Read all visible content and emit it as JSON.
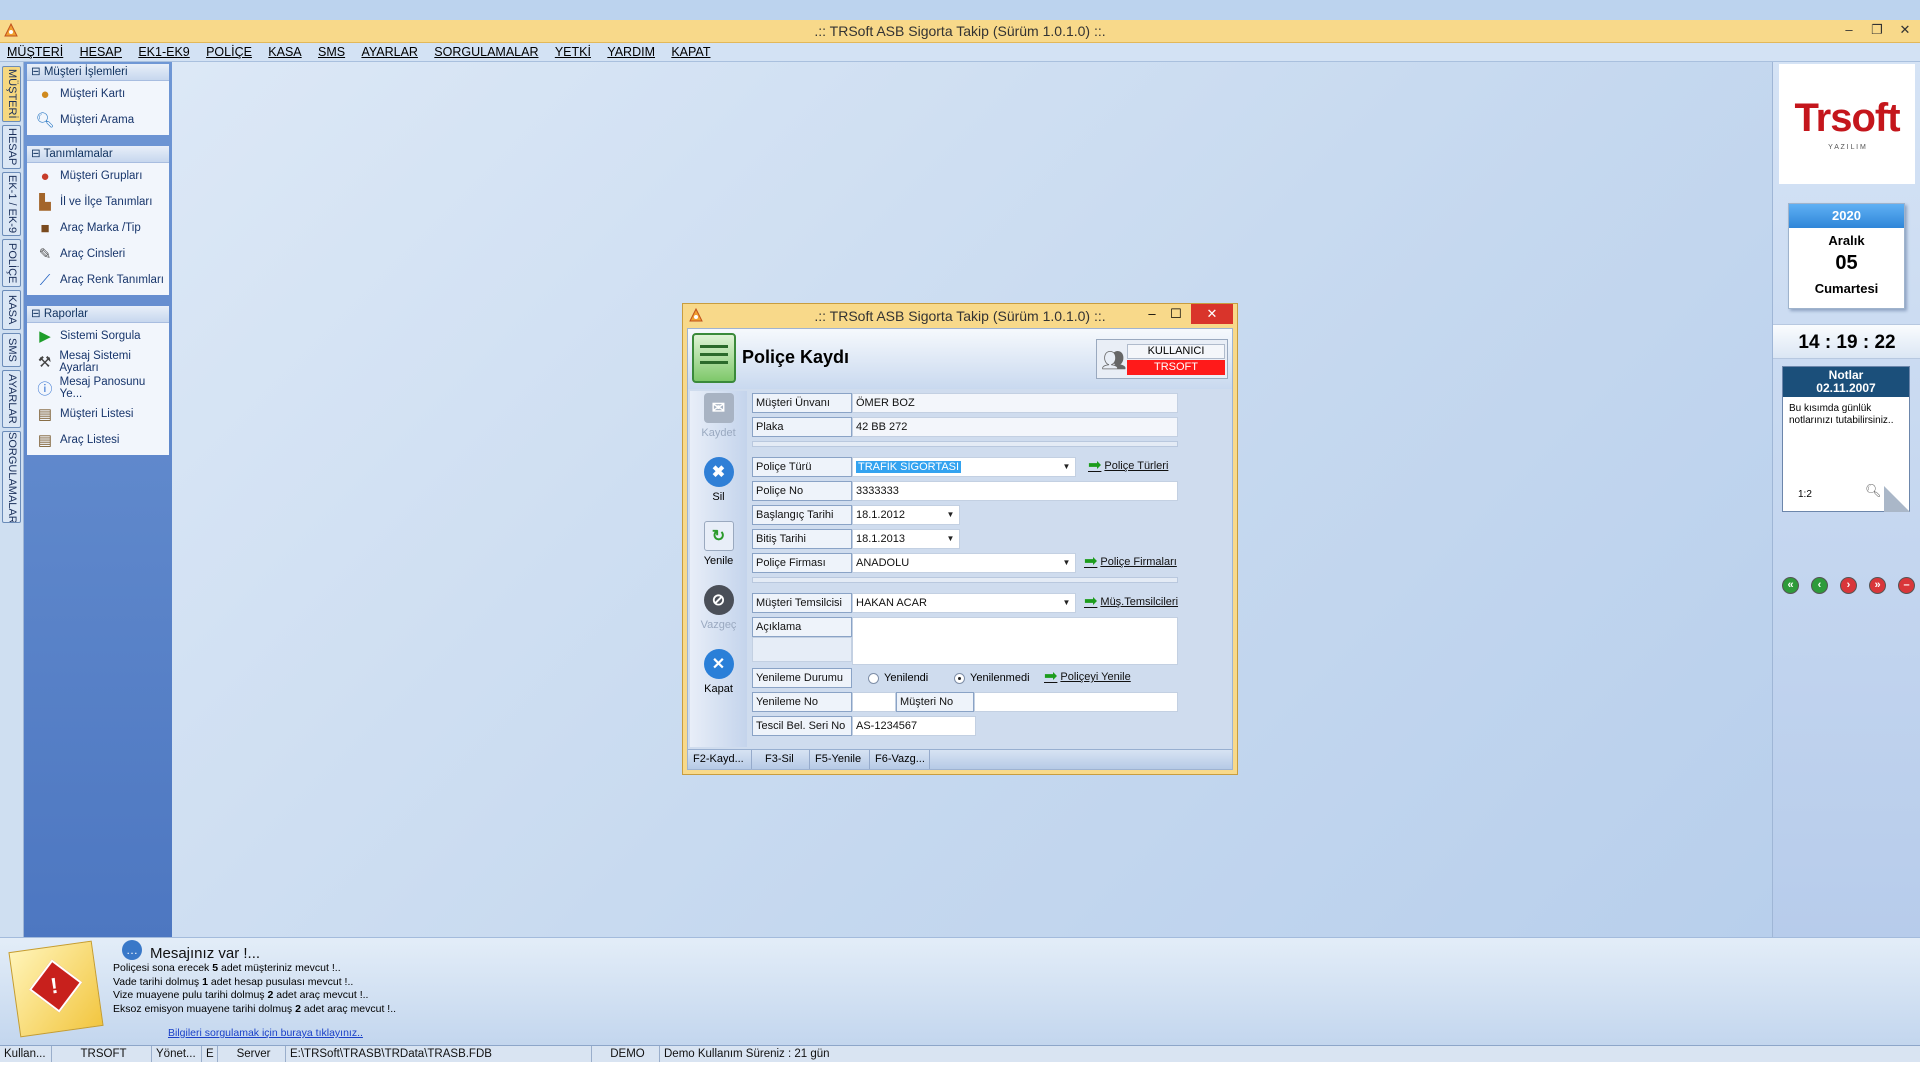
{
  "app": {
    "title": ".:: TRSoft ASB Sigorta Takip (Sürüm 1.0.1.0) ::.",
    "min": "–",
    "max": "❐",
    "close": "✕"
  },
  "menu": [
    "MÜŞTERİ",
    "HESAP",
    "EK1-EK9",
    "POLİÇE",
    "KASA",
    "SMS",
    "AYARLAR",
    "SORGULAMALAR",
    "YETKİ",
    "YARDIM",
    "KAPAT"
  ],
  "vtabs": [
    "MÜŞTERİ",
    "HESAP",
    "EK-1 / EK-9",
    "POLİÇE",
    "KASA",
    "SMS",
    "AYARLAR",
    "SORGULAMALAR"
  ],
  "sidebar": {
    "groups": [
      {
        "title": "Müşteri İşlemleri",
        "items": [
          {
            "label": "Müşteri Kartı",
            "icon": "user-icon"
          },
          {
            "label": "Müşteri Arama",
            "icon": "magnifier-icon"
          }
        ]
      },
      {
        "title": "Tanımlamalar",
        "items": [
          {
            "label": "Müşteri Grupları",
            "icon": "users-group-icon"
          },
          {
            "label": "İl ve İlçe Tanımları",
            "icon": "city-icon"
          },
          {
            "label": "Araç Marka /Tip",
            "icon": "car-icon"
          },
          {
            "label": "Araç Cinsleri",
            "icon": "document-edit-icon"
          },
          {
            "label": "Araç Renk Tanımları",
            "icon": "brush-icon"
          }
        ]
      },
      {
        "title": "Raporlar",
        "items": [
          {
            "label": "Sistemi Sorgula",
            "icon": "play-icon"
          },
          {
            "label": "Mesaj Sistemi Ayarları",
            "icon": "tools-icon"
          },
          {
            "label": "Mesaj Panosunu Ye...",
            "icon": "info-icon"
          },
          {
            "label": "Müşteri Listesi",
            "icon": "list-icon"
          },
          {
            "label": "Araç Listesi",
            "icon": "list-icon"
          }
        ]
      }
    ]
  },
  "right": {
    "logo_main": "Trsoft",
    "logo_sub": "Y A Z I L I M",
    "calendar": {
      "year": "2020",
      "month": "Aralık",
      "day": "05",
      "weekday": "Cumartesi"
    },
    "clock": "14 : 19 : 22",
    "notes": {
      "title": "Notlar",
      "date": "02.11.2007",
      "text": "Bu kısımda günlük notlarınızı tutabilirsiniz..",
      "page": "1:2"
    }
  },
  "dialog": {
    "title": ".:: TRSoft ASB Sigorta Takip (Sürüm 1.0.1.0) ::.",
    "heading": "Poliçe Kaydı",
    "user_label": "KULLANICI",
    "user_name": "TRSOFT",
    "toolbar": [
      {
        "label": "Kaydet",
        "enabled": false
      },
      {
        "label": "Sil",
        "enabled": true
      },
      {
        "label": "Yenile",
        "enabled": true
      },
      {
        "label": "Vazgeç",
        "enabled": false
      },
      {
        "label": "Kapat",
        "enabled": true
      }
    ],
    "fields": {
      "musteri_unvani": {
        "label": "Müşteri Ünvanı",
        "value": "ÖMER BOZ"
      },
      "plaka": {
        "label": "Plaka",
        "value": "42 BB 272"
      },
      "police_turu": {
        "label": "Poliçe Türü",
        "value": "TRAFİK SİGORTASI"
      },
      "police_no": {
        "label": "Poliçe No",
        "value": "3333333"
      },
      "baslangic": {
        "label": "Başlangıç Tarihi",
        "value": "18.1.2012"
      },
      "bitis": {
        "label": "Bitiş Tarihi",
        "value": "18.1.2013"
      },
      "firma": {
        "label": "Poliçe Firması",
        "value": "ANADOLU"
      },
      "temsilci": {
        "label": "Müşteri Temsilcisi",
        "value": "HAKAN ACAR"
      },
      "aciklama": {
        "label": "Açıklama",
        "value": ""
      },
      "yenileme_durumu": {
        "label": "Yenileme Durumu",
        "options": [
          "Yenilendi",
          "Yenilenmedi"
        ],
        "selected": "Yenilenmedi"
      },
      "yenileme_no": {
        "label": "Yenileme No",
        "value": ""
      },
      "musteri_no": {
        "label": "Müşteri No",
        "value": ""
      },
      "tescil": {
        "label": "Tescil Bel. Seri No",
        "value": "AS-1234567"
      }
    },
    "links": {
      "police_turleri": "Poliçe Türleri",
      "police_firmalari": "Poliçe Firmaları",
      "mus_temsilcileri": "Müş.Temsilcileri",
      "policeyi_yenile": "Poliçeyi Yenile"
    },
    "status": [
      "F2-Kayd...",
      "F3-Sil",
      "F5-Yenile",
      "F6-Vazg..."
    ]
  },
  "messages": {
    "title": "Mesajınız var !...",
    "lines": [
      [
        "Poliçesi sona erecek ",
        "5",
        " adet müşteriniz mevcut !.."
      ],
      [
        "Vade tarihi dolmuş ",
        "1",
        " adet hesap pusulası mevcut !.."
      ],
      [
        "Vize muayene pulu tarihi dolmuş ",
        "2",
        " adet araç mevcut !.."
      ],
      [
        "Eksoz emisyon muayene tarihi dolmuş ",
        "2",
        " adet araç mevcut !.."
      ]
    ],
    "link": "Bilgileri sorgulamak için buraya tıklayınız.."
  },
  "statusbar": [
    "Kullan...",
    "TRSOFT",
    "Yönet...",
    "E",
    "Server",
    "E:\\TRSoft\\TRASB\\TRData\\TRASB.FDB",
    "DEMO",
    "Demo Kullanım Süreniz : 21 gün"
  ],
  "colors": {
    "accent": "#f8d98a",
    "sidebar": "#5b84c8",
    "user_badge": "#ff1a1a",
    "calendar_head": "#2f8fe0",
    "notes_head": "#1b4f7a"
  }
}
